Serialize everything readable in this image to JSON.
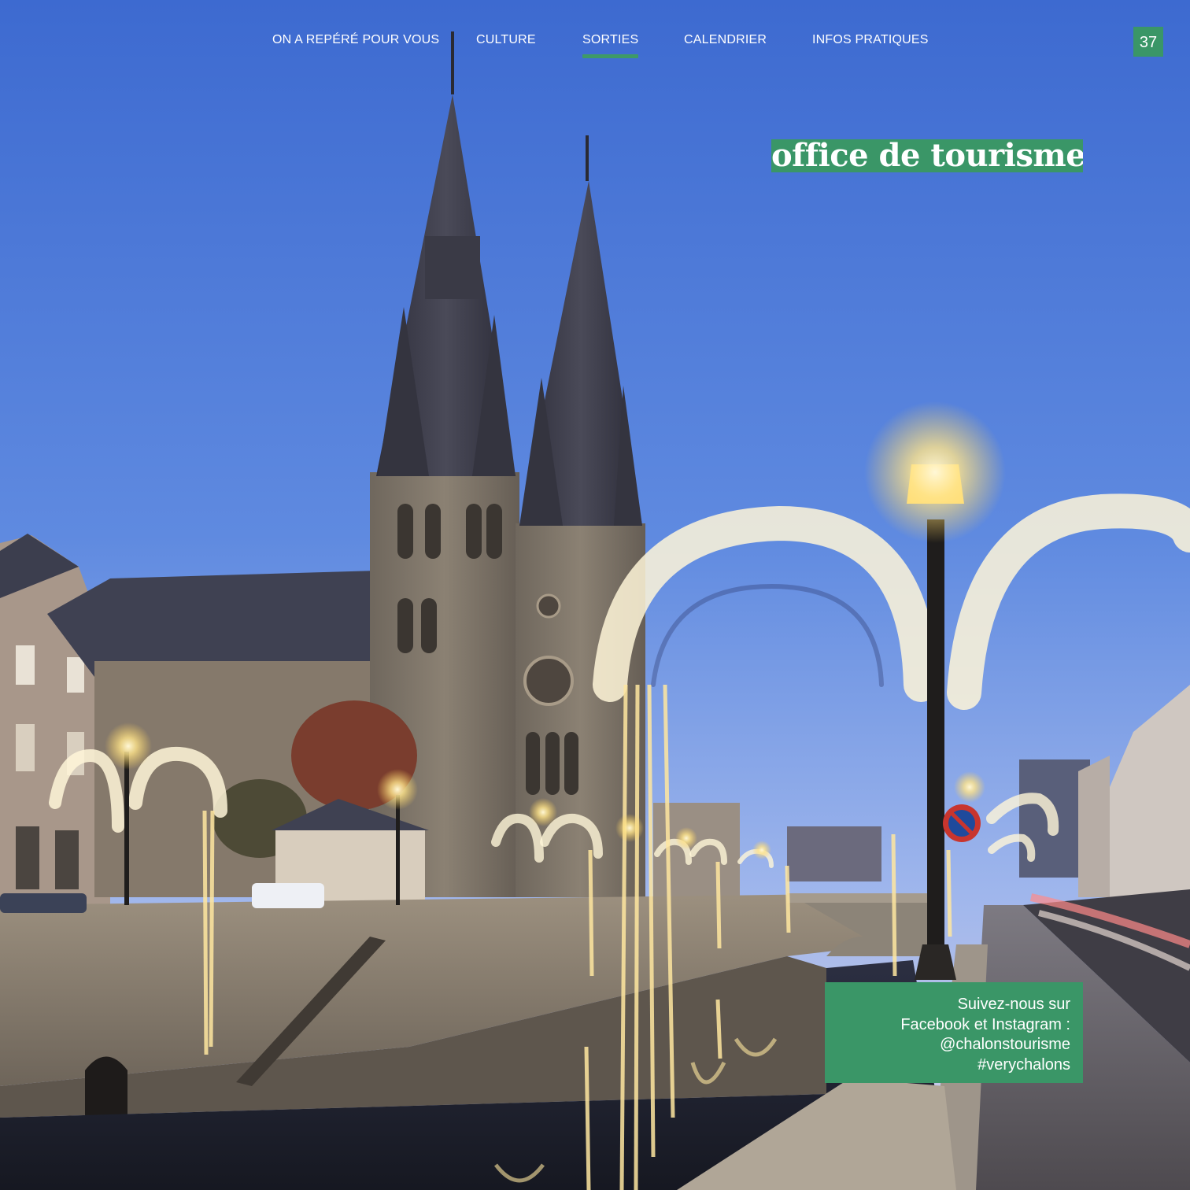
{
  "nav": {
    "items": [
      {
        "label": "ON A REPÉRÉ POUR VOUS",
        "active": false
      },
      {
        "label": "CULTURE",
        "active": false
      },
      {
        "label": "SORTIES",
        "active": true
      },
      {
        "label": "CALENDRIER",
        "active": false
      },
      {
        "label": "INFOS PRATIQUES",
        "active": false
      }
    ]
  },
  "page_number": "37",
  "section_title": "office de tourisme",
  "social": {
    "lines": [
      "Suivez-nous sur",
      "Facebook et Instagram :",
      "@chalonstourisme",
      "#verychalons"
    ]
  },
  "colors": {
    "accent_green": "#3a9667",
    "sky_top": "#3f6fd2",
    "sky_horizon": "#b8c6ea",
    "stone": "#8f8272",
    "lights": "#fff3c4"
  },
  "photo": {
    "subject": "Cathedral with twin spires at dusk, illuminated Christmas light arches along a canal"
  }
}
